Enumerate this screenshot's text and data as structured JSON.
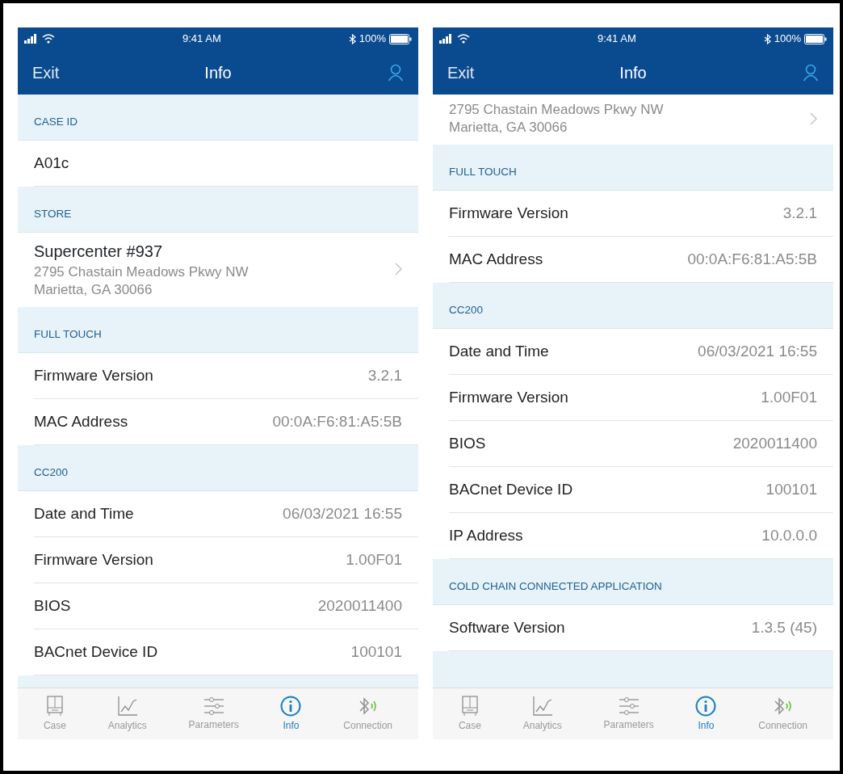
{
  "screens": [
    {
      "status_bar": {
        "time": "9:41 AM",
        "battery": "100%"
      },
      "nav": {
        "left": "Exit",
        "title": "Info"
      },
      "sections": [
        {
          "kind": "header",
          "text": "CASE ID"
        },
        {
          "kind": "text",
          "text": "A01c"
        },
        {
          "kind": "header",
          "text": "STORE"
        },
        {
          "kind": "address",
          "title": "Supercenter #937",
          "lines": [
            "2795 Chastain Meadows Pkwy NW",
            "Marietta, GA 30066"
          ]
        },
        {
          "kind": "header",
          "text": "FULL TOUCH"
        },
        {
          "kind": "pair",
          "label": "Firmware Version",
          "value": "3.2.1"
        },
        {
          "kind": "pair",
          "label": "MAC Address",
          "value": "00:0A:F6:81:A5:5B"
        },
        {
          "kind": "header",
          "text": "CC200"
        },
        {
          "kind": "pair",
          "label": "Date and Time",
          "value": "06/03/2021 16:55"
        },
        {
          "kind": "pair",
          "label": "Firmware Version",
          "value": "1.00F01"
        },
        {
          "kind": "pair",
          "label": "BIOS",
          "value": "2020011400"
        },
        {
          "kind": "pair",
          "label": "BACnet Device ID",
          "value": "100101"
        }
      ],
      "tab_bar": [
        {
          "label": "Case",
          "selected": false
        },
        {
          "label": "Analytics",
          "selected": false
        },
        {
          "label": "Parameters",
          "selected": false
        },
        {
          "label": "Info",
          "selected": true
        },
        {
          "label": "Connection",
          "selected": false
        }
      ]
    },
    {
      "status_bar": {
        "time": "9:41 AM",
        "battery": "100%"
      },
      "nav": {
        "left": "Exit",
        "title": "Info"
      },
      "sections": [
        {
          "kind": "address",
          "lines": [
            "2795 Chastain Meadows Pkwy NW",
            "Marietta, GA 30066"
          ]
        },
        {
          "kind": "header",
          "text": "FULL TOUCH"
        },
        {
          "kind": "pair",
          "label": "Firmware Version",
          "value": "3.2.1"
        },
        {
          "kind": "pair",
          "label": "MAC Address",
          "value": "00:0A:F6:81:A5:5B"
        },
        {
          "kind": "header",
          "text": "CC200"
        },
        {
          "kind": "pair",
          "label": "Date and Time",
          "value": "06/03/2021 16:55"
        },
        {
          "kind": "pair",
          "label": "Firmware Version",
          "value": "1.00F01"
        },
        {
          "kind": "pair",
          "label": "BIOS",
          "value": "2020011400"
        },
        {
          "kind": "pair",
          "label": "BACnet Device ID",
          "value": "100101"
        },
        {
          "kind": "pair",
          "label": "IP Address",
          "value": "10.0.0.0"
        },
        {
          "kind": "header",
          "text": "COLD CHAIN CONNECTED APPLICATION"
        },
        {
          "kind": "pair",
          "label": "Software Version",
          "value": "1.3.5 (45)"
        }
      ],
      "tab_bar": [
        {
          "label": "Case",
          "selected": false
        },
        {
          "label": "Analytics",
          "selected": false
        },
        {
          "label": "Parameters",
          "selected": false
        },
        {
          "label": "Info",
          "selected": true
        },
        {
          "label": "Connection",
          "selected": false
        }
      ]
    }
  ]
}
